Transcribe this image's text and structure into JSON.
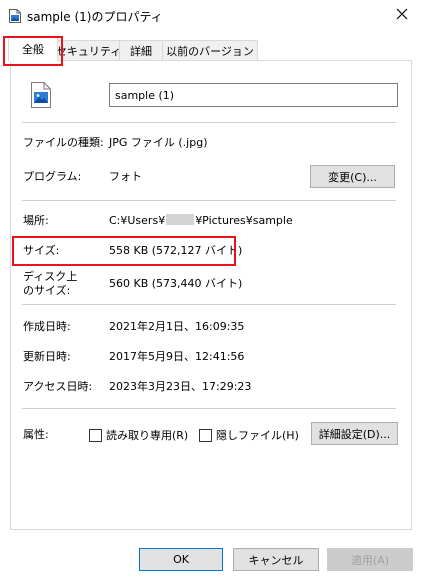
{
  "window": {
    "title": "sample (1)のプロパティ",
    "icon": "document-image-icon",
    "close_icon": "close-icon"
  },
  "tabs": [
    {
      "label": "全般",
      "active": true
    },
    {
      "label": "セキュリティ",
      "active": false
    },
    {
      "label": "詳細",
      "active": false
    },
    {
      "label": "以前のバージョン",
      "active": false
    }
  ],
  "file": {
    "icon": "jpg-image-file-icon",
    "name": "sample (1)"
  },
  "properties": {
    "type_label": "ファイルの種類:",
    "type_value": "JPG ファイル (.jpg)",
    "program_label": "プログラム:",
    "program_value": "フォト",
    "change_button": "変更(C)...",
    "location_label": "場所:",
    "location_prefix": "C:¥Users¥",
    "location_suffix": "¥Pictures¥sample",
    "size_label": "サイズ:",
    "size_value": "558 KB (572,127 バイト)",
    "disk_size_label_line1": "ディスク上",
    "disk_size_label_line2": "のサイズ:",
    "disk_size_value": "560 KB (573,440 バイト)",
    "created_label": "作成日時:",
    "created_value": "2021年2月1日、16:09:35",
    "modified_label": "更新日時:",
    "modified_value": "2017年5月9日、12:41:56",
    "accessed_label": "アクセス日時:",
    "accessed_value": "2023年3月23日、17:29:23",
    "attributes_label": "属性:",
    "readonly_label": "読み取り専用(R)",
    "readonly_checked": false,
    "hidden_label": "隠しファイル(H)",
    "hidden_checked": false,
    "advanced_button": "詳細設定(D)..."
  },
  "footer": {
    "ok": "OK",
    "cancel": "キャンセル",
    "apply": "適用(A)"
  },
  "colors": {
    "highlight_red": "#e8131b",
    "default_button_border": "#0078d7",
    "button_face": "#e1e1e1"
  }
}
